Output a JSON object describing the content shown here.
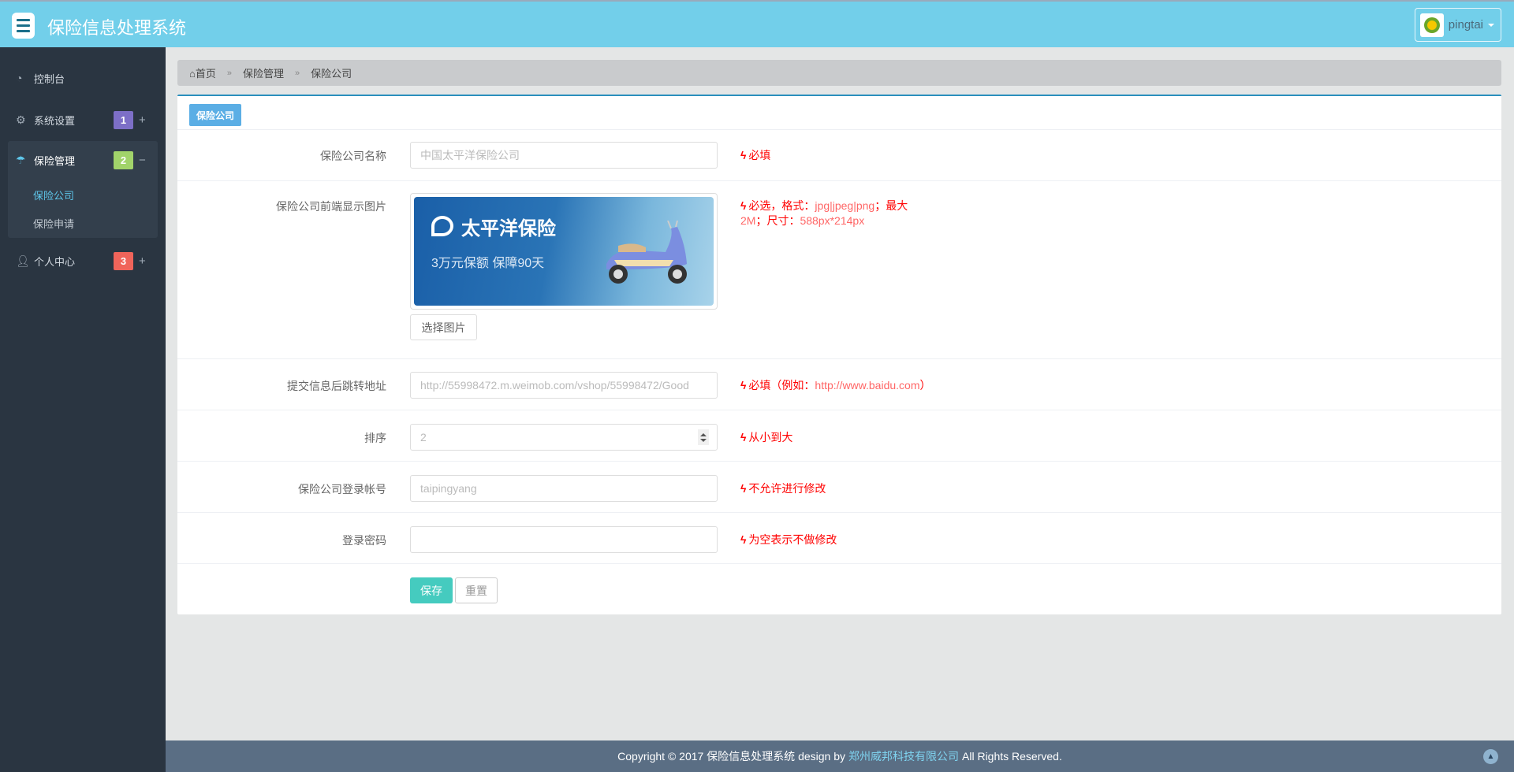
{
  "header": {
    "title": "保险信息处理系统",
    "user": "pingtai"
  },
  "sidebar": {
    "items": [
      {
        "label": "控制台",
        "icon": "dashboard-icon"
      },
      {
        "label": "系统设置",
        "icon": "cogs-icon",
        "badge": "1",
        "toggle": "+",
        "badge_color": "#7d6fc7"
      },
      {
        "label": "保险管理",
        "icon": "umbrella-icon",
        "badge": "2",
        "toggle": "−",
        "badge_color": "#a1d36a",
        "children": [
          {
            "label": "保险公司",
            "active": true
          },
          {
            "label": "保险申请"
          }
        ]
      },
      {
        "label": "个人中心",
        "icon": "user-icon",
        "badge": "3",
        "toggle": "+",
        "badge_color": "#f0645a"
      }
    ]
  },
  "breadcrumb": {
    "items": [
      "首页",
      "保险管理",
      "保险公司"
    ],
    "separator": "»"
  },
  "panel": {
    "tag": "保险公司",
    "fields": [
      {
        "label": "保险公司名称",
        "placeholder": "中国太平洋保险公司",
        "hint": "必填"
      },
      {
        "label": "保险公司前端显示图片",
        "hint_parts": [
          "必选，格式：",
          "jpg|jpeg|png",
          "；最大",
          "2M",
          "；尺寸：",
          "588px*214px"
        ],
        "choose_button": "选择图片",
        "banner": {
          "title": "太平洋保险",
          "subtitle": "3万元保额 保障90天"
        }
      },
      {
        "label": "提交信息后跳转地址",
        "placeholder": "http://55998472.m.weimob.com/vshop/55998472/Good",
        "hint_parts": [
          "必填（例如：",
          "http://www.baidu.com",
          "）"
        ]
      },
      {
        "label": "排序",
        "value": "2",
        "hint": "从小到大"
      },
      {
        "label": "保险公司登录帐号",
        "placeholder": "taipingyang",
        "hint": "不允许进行修改"
      },
      {
        "label": "登录密码",
        "value": "",
        "hint": "为空表示不做修改"
      }
    ],
    "save": "保存",
    "reset": "重置"
  },
  "footer": {
    "prefix": "Copyright © 2017 保险信息处理系统 design by",
    "company": "郑州威邦科技有限公司",
    "suffix": "All Rights Reserved."
  },
  "colors": {
    "header": "#72cfea",
    "sidebar": "#2a3541",
    "accent": "#5baee5",
    "save": "#45cbbf",
    "hint": "#ff0000",
    "footer": "#5a6e84"
  }
}
